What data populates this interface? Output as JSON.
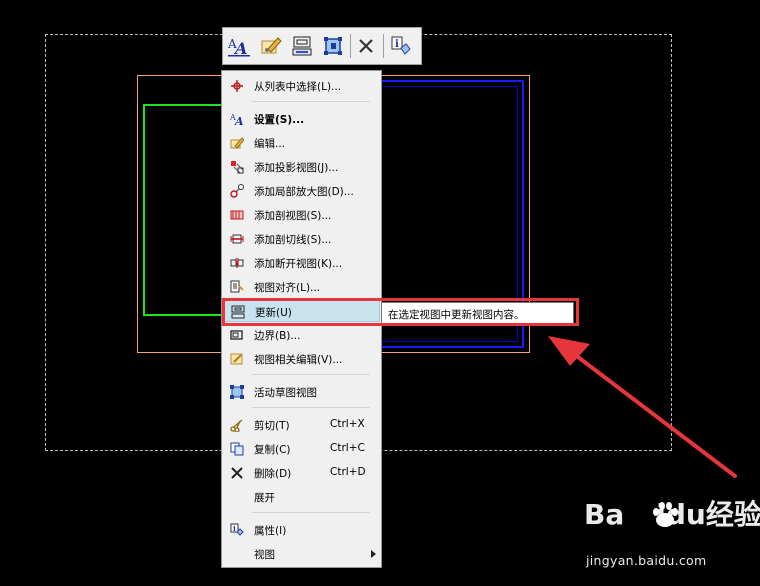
{
  "toolbar": {
    "items": [
      {
        "icon": "text-style-icon"
      },
      {
        "icon": "edit-icon"
      },
      {
        "icon": "update-view-icon"
      },
      {
        "icon": "sketch-view-icon"
      },
      {
        "icon": "close-icon"
      },
      {
        "icon": "properties-icon"
      }
    ]
  },
  "menu": {
    "items": [
      {
        "label": "从列表中选择(L)...",
        "icon": "crosshair-icon"
      },
      {
        "label": "设置(S)...",
        "icon": "text-style-icon",
        "bold": true
      },
      {
        "label": "编辑...",
        "icon": "edit-icon"
      },
      {
        "label": "添加投影视图(J)...",
        "icon": "projection-view-icon"
      },
      {
        "label": "添加局部放大图(D)...",
        "icon": "detail-view-icon"
      },
      {
        "label": "添加剖视图(S)...",
        "icon": "section-view-icon"
      },
      {
        "label": "添加剖切线(S)...",
        "icon": "section-line-icon"
      },
      {
        "label": "添加断开视图(K)...",
        "icon": "break-view-icon"
      },
      {
        "label": "视图对齐(L)...",
        "icon": "align-view-icon"
      },
      {
        "label": "更新(U)",
        "icon": "update-view-icon",
        "highlighted": true
      },
      {
        "label": "边界(B)...",
        "icon": "boundary-icon"
      },
      {
        "label": "视图相关编辑(V)...",
        "icon": "view-edit-icon"
      },
      {
        "label": "活动草图视图",
        "icon": "sketch-view-icon"
      },
      {
        "label": "剪切(T)",
        "icon": "cut-icon",
        "shortcut": "Ctrl+X"
      },
      {
        "label": "复制(C)",
        "icon": "copy-icon",
        "shortcut": "Ctrl+C"
      },
      {
        "label": "删除(D)",
        "icon": "delete-icon",
        "shortcut": "Ctrl+D"
      },
      {
        "label": "展开",
        "icon": ""
      },
      {
        "label": "属性(I)",
        "icon": "properties-icon"
      },
      {
        "label": "视图",
        "icon": "",
        "submenu": true
      }
    ]
  },
  "tooltip": {
    "text": "在选定视图中更新视图内容。"
  },
  "watermark": {
    "brand": "Baidu经验",
    "url": "jingyan.baidu.com"
  },
  "colors": {
    "highlight": "#c8e3ee",
    "annotation_red": "#e8353b",
    "green_frame": "#1ee31e",
    "blue_frame": "#1a1aff",
    "orange_frame": "#f5a26b"
  }
}
